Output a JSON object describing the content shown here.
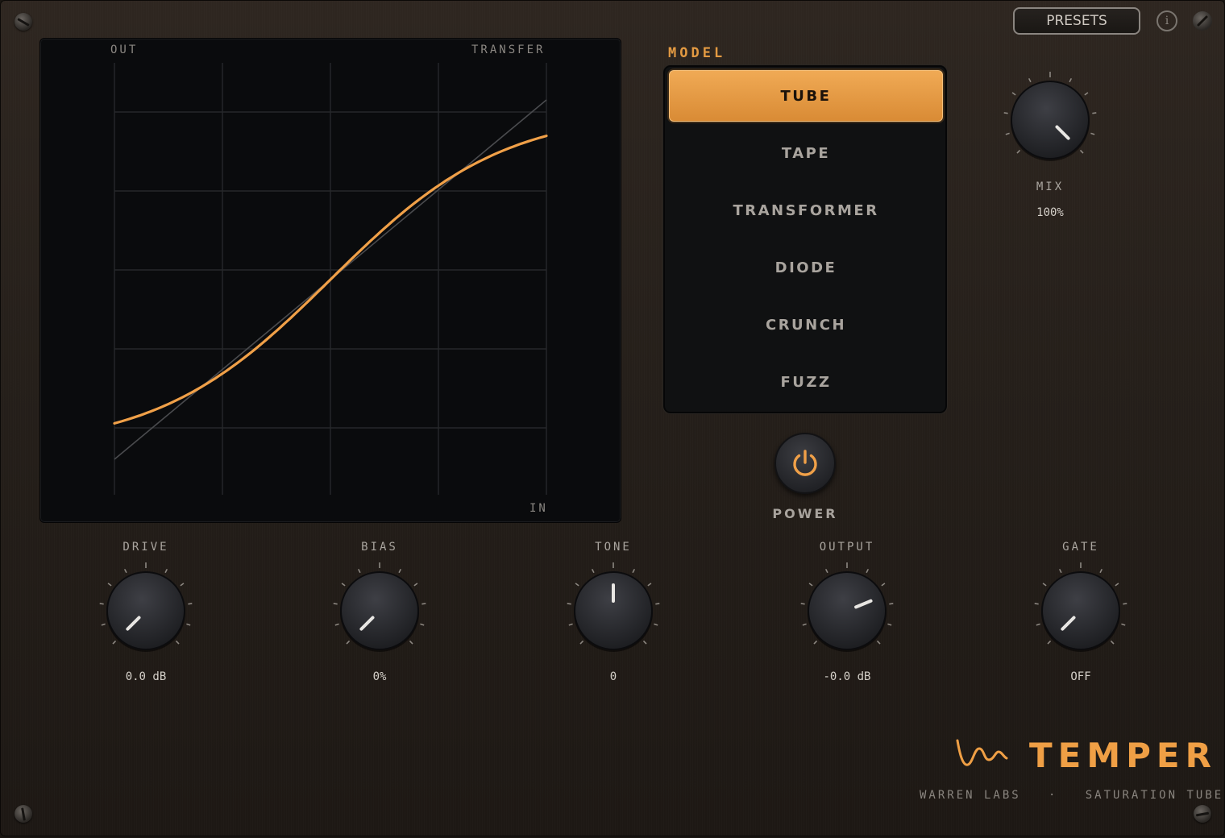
{
  "toolbar": {
    "presets_label": "PRESETS",
    "info_icon": "info-icon",
    "info_glyph": "i",
    "edit_icon": "edit-icon"
  },
  "graph": {
    "out_label": "OUT",
    "title": "TRANSFER",
    "in_label": "IN",
    "curve_color": "#f0a048"
  },
  "model": {
    "title": "MODEL",
    "selected": "TUBE",
    "options": [
      "TUBE",
      "TAPE",
      "TRANSFORMER",
      "DIODE",
      "CRUNCH",
      "FUZZ"
    ]
  },
  "power": {
    "label": "POWER",
    "on": true,
    "icon": "power-icon"
  },
  "mix": {
    "label": "MIX",
    "value": "100%",
    "fraction": 1.0
  },
  "knobs": [
    {
      "id": "drive",
      "label": "DRIVE",
      "value": "0.0 dB",
      "fraction": 0.0
    },
    {
      "id": "bias",
      "label": "BIAS",
      "value": "0%",
      "fraction": 0.0
    },
    {
      "id": "tone",
      "label": "TONE",
      "value": "0",
      "fraction": 0.5
    },
    {
      "id": "output",
      "label": "OUTPUT",
      "value": "-0.0 dB",
      "fraction": 0.75
    },
    {
      "id": "gate",
      "label": "GATE",
      "value": "OFF",
      "fraction": 0.0
    }
  ],
  "brand": {
    "name": "TEMPER",
    "maker": "WARREN LABS",
    "separator": "·",
    "product": "SATURATION TUBE",
    "accent": "#ef9f45"
  }
}
